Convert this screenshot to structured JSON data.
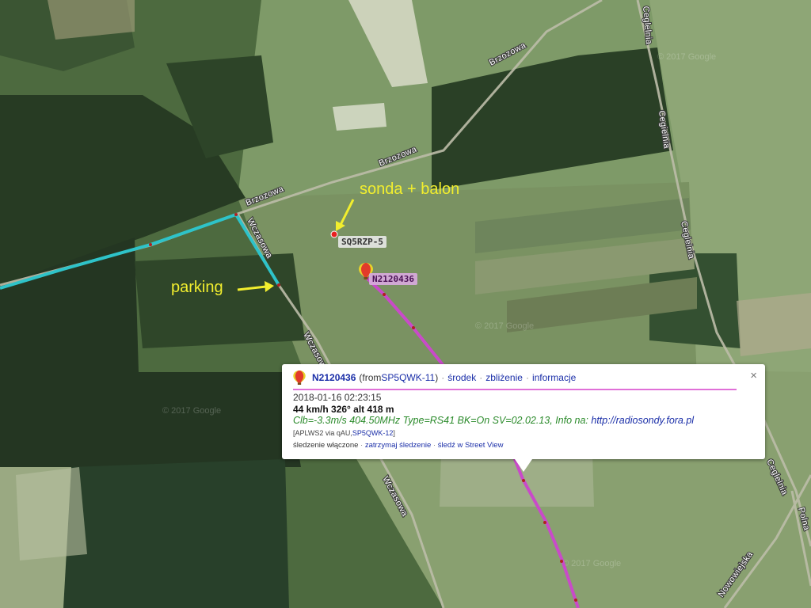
{
  "map": {
    "roads": {
      "brzozowa_1": "Brzozowa",
      "brzozowa_2": "Brzozowa",
      "brzozowa_3": "Brzozowa",
      "wczasowa_1": "Wczasowa",
      "wczasowa_2": "Wczasowa",
      "wczasowa_3": "Wczasowa",
      "ceglelnia_1": "Ceglelnia",
      "ceglelnia_2": "Cegielnia",
      "ceglelnia_3": "Ceglelnia",
      "ceglelnia_4": "Ceglelnia",
      "polna": "Polna",
      "nowowiejska": "Nowowiejska"
    },
    "annotations": {
      "sonda": "sonda + balon",
      "parking": "parking"
    },
    "watermark": "© 2017 Google",
    "colors": {
      "track_balloon": "#c94ac9",
      "track_chase": "#2ec3c9",
      "annotation": "#f2ee2e"
    }
  },
  "stations": {
    "sq5rzp": "SQ5RZP-5",
    "balloon": "N2120436"
  },
  "popup": {
    "icon": "balloon-icon",
    "callsign": "N2120436",
    "from_prefix": "(from ",
    "from_station": "SP5QWK-11",
    "from_suffix": ")",
    "link_center": "środek",
    "link_zoom": "zbliżenie",
    "link_info": "informacje",
    "timestamp": "2018-01-16 02:23:15",
    "speed_alt": "44 km/h 326° alt 418 m",
    "comment": "Clb=-3.3m/s 404.50MHz Type=RS41 BK=On SV=02.02.13, Info na: ",
    "comment_link": "http://radiosondy.fora.pl",
    "path_prefix": "[APLWS2 via qAU,",
    "path_link": "SP5QWK-12",
    "path_suffix": "]",
    "tracking_on": "śledzenie włączone",
    "stop_tracking": "zatrzymaj śledzenie",
    "street_view": "śledź w Street View",
    "close_glyph": "×"
  }
}
